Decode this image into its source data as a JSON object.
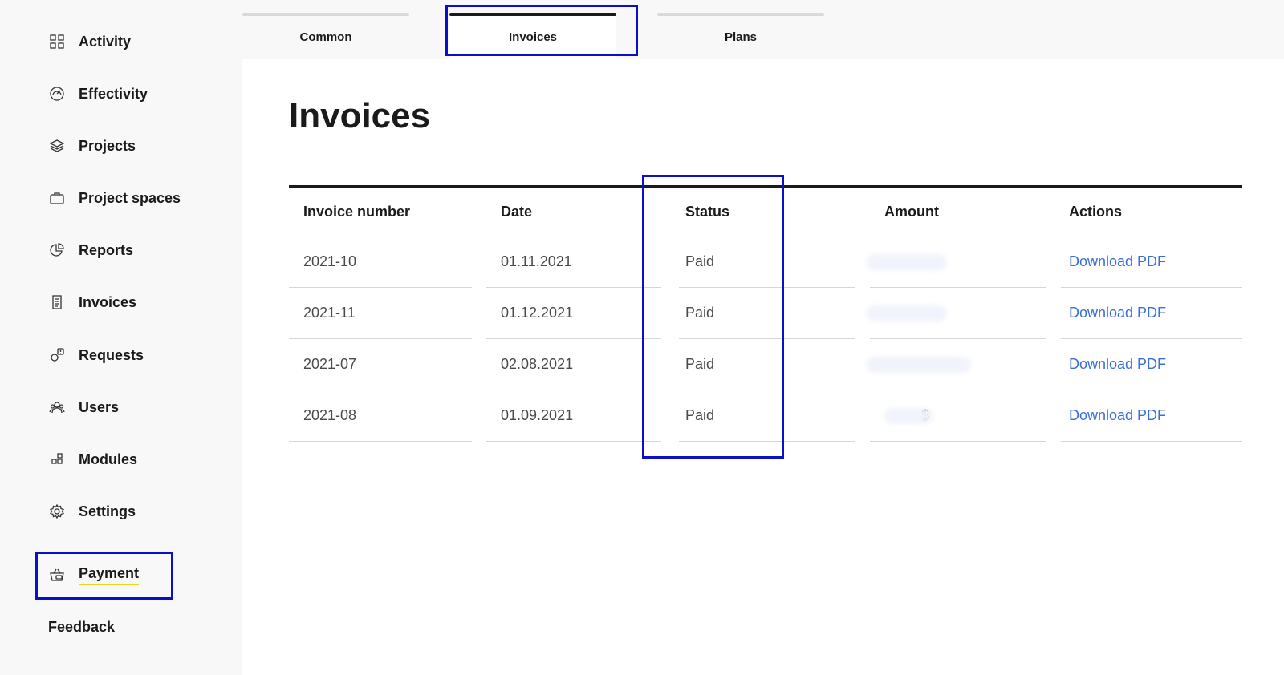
{
  "sidebar": {
    "items": [
      {
        "label": "Activity",
        "icon": "grid-icon"
      },
      {
        "label": "Effectivity",
        "icon": "gauge-icon"
      },
      {
        "label": "Projects",
        "icon": "layers-icon"
      },
      {
        "label": "Project spaces",
        "icon": "briefcase-icon"
      },
      {
        "label": "Reports",
        "icon": "pie-chart-icon"
      },
      {
        "label": "Invoices",
        "icon": "receipt-icon"
      },
      {
        "label": "Requests",
        "icon": "alert-request-icon"
      },
      {
        "label": "Users",
        "icon": "users-icon"
      },
      {
        "label": "Modules",
        "icon": "modules-icon"
      },
      {
        "label": "Settings",
        "icon": "gear-icon"
      },
      {
        "label": "Payment",
        "icon": "basket-icon"
      }
    ],
    "active": "Payment",
    "feedback_label": "Feedback"
  },
  "tabs": [
    {
      "label": "Common"
    },
    {
      "label": "Invoices"
    },
    {
      "label": "Plans"
    }
  ],
  "active_tab": "Invoices",
  "main": {
    "title": "Invoices",
    "table": {
      "headers": [
        "Invoice number",
        "Date",
        "Status",
        "Amount",
        "Actions"
      ],
      "rows": [
        {
          "number": "2021-10",
          "date": "01.11.2021",
          "status": "Paid",
          "amount": "",
          "action": "Download PDF"
        },
        {
          "number": "2021-11",
          "date": "01.12.2021",
          "status": "Paid",
          "amount": "",
          "action": "Download PDF"
        },
        {
          "number": "2021-07",
          "date": "02.08.2021",
          "status": "Paid",
          "amount": "",
          "action": "Download PDF"
        },
        {
          "number": "2021-08",
          "date": "01.09.2021",
          "status": "Paid",
          "amount": "$",
          "action": "Download PDF"
        }
      ]
    }
  },
  "colors": {
    "highlight": "#0a10c8",
    "link": "#3a6fd8",
    "active_underline": "#f0d21c"
  }
}
